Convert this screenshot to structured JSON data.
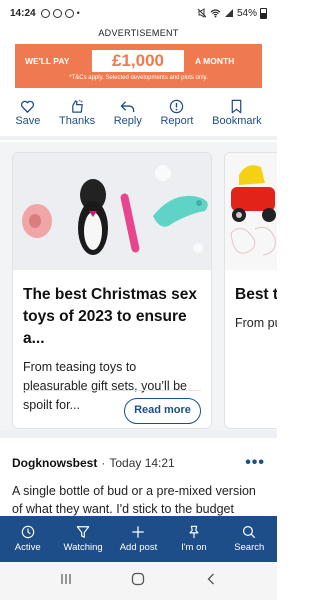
{
  "status": {
    "time": "14:24",
    "battery": "54%"
  },
  "ad": {
    "label": "ADVERTISEMENT",
    "left_text": "WE'LL PAY",
    "price": "£1,000",
    "right_text": "A MONTH",
    "tc": "*T&Cs apply. Selected developments and plots only."
  },
  "actions": [
    {
      "label": "Save",
      "icon": "heart-icon"
    },
    {
      "label": "Thanks",
      "icon": "thanks-icon"
    },
    {
      "label": "Reply",
      "icon": "reply-icon"
    },
    {
      "label": "Report",
      "icon": "alert-icon"
    },
    {
      "label": "Bookmark",
      "icon": "bookmark-icon"
    }
  ],
  "cards": [
    {
      "title": "The best Christmas sex toys of 2023 to ensure a...",
      "desc": "From teasing toys to pleasurable gift sets, you’ll be spoilt for...",
      "button": "Read more"
    },
    {
      "title": "Best to our gu",
      "desc": "From pu tracks a"
    }
  ],
  "post": {
    "user": "Dogknowsbest",
    "separator": "·",
    "time": "Today 14:21",
    "more": "•••",
    "body": "A single bottle of bud or a pre-mixed version of what they want. I'd stick to the budget"
  },
  "nav": [
    {
      "label": "Active",
      "icon": "clock-icon"
    },
    {
      "label": "Watching",
      "icon": "filter-icon"
    },
    {
      "label": "Add post",
      "icon": "plus-icon"
    },
    {
      "label": "I'm on",
      "icon": "pin-icon"
    },
    {
      "label": "Search",
      "icon": "search-icon"
    }
  ],
  "colors": {
    "brand": "#1d4e89",
    "ad": "#ef7a4f"
  }
}
